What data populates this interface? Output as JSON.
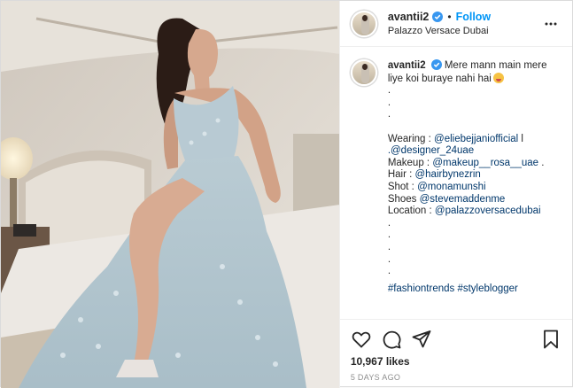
{
  "post": {
    "username": "avantii2",
    "follow_label": "Follow",
    "separator": "•",
    "location": "Palazzo Versace Dubai",
    "image_alt": "photo",
    "caption": {
      "username": "avantii2",
      "text_line1": "Mere mann main mere",
      "text_line2": "liye koi buraye nahi hai",
      "dots_a": [
        ".",
        ".",
        "."
      ],
      "wearing_label": "Wearing : ",
      "wearing_link1": "@eliebejjaniofficial",
      "wearing_sep": " l",
      "wearing_link2": ".@designer_24uae",
      "makeup_label": "Makeup : ",
      "makeup_link": "@makeup__rosa__uae",
      "makeup_suffix": " .",
      "hair_label": "Hair : ",
      "hair_link": "@hairbynezrin",
      "shot_label": "Shot : ",
      "shot_link": "@monamunshi",
      "shoes_label": "Shoes ",
      "shoes_link": "@stevemaddenme",
      "location_label": "Location : ",
      "location_link": "@palazzoversacedubai",
      "dots_b": [
        ".",
        ".",
        ".",
        ".",
        "."
      ],
      "hashtags": "#fashiontrends #styleblogger"
    },
    "likes": "10,967 likes",
    "timestamp": "5 DAYS AGO"
  },
  "icons": {
    "verified": "verified-badge-icon",
    "more": "more-options-icon",
    "like": "heart-icon",
    "comment": "comment-icon",
    "share": "paper-plane-icon",
    "save": "bookmark-icon"
  },
  "colors": {
    "follow": "#0095f6",
    "link": "#00376b",
    "verified": "#3897f0",
    "muted": "#8e8e8e"
  }
}
